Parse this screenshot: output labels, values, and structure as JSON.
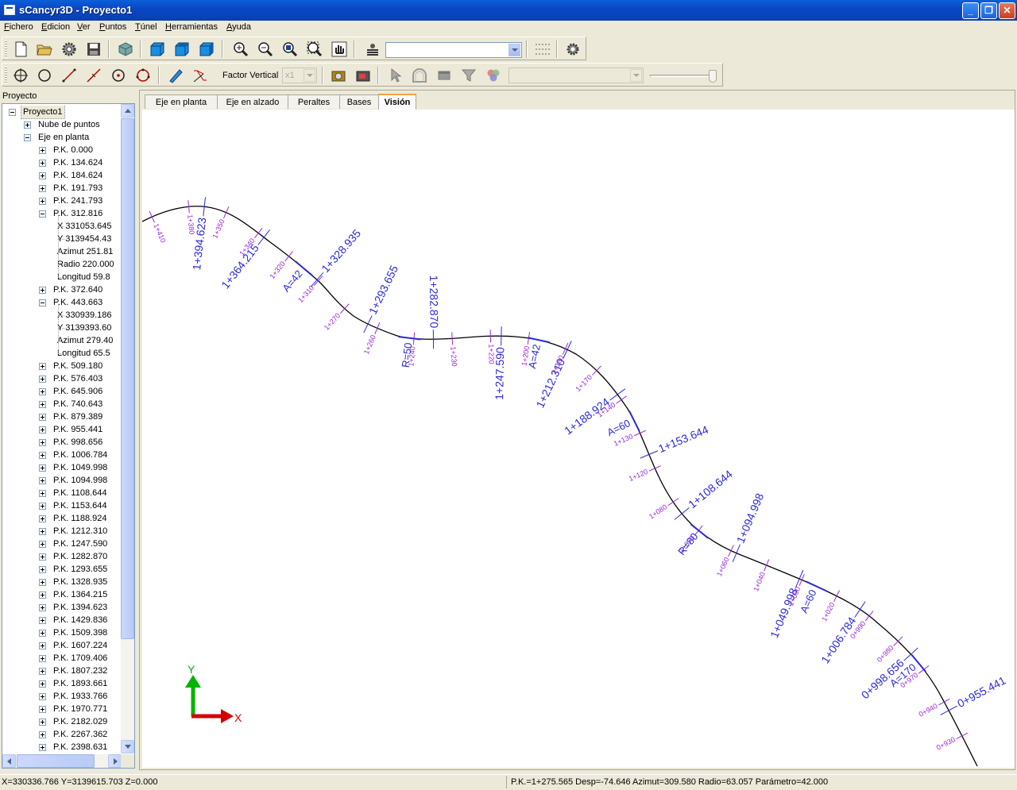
{
  "window": {
    "title": "sCancyr3D - Proyecto1",
    "buttons": {
      "minimize": "_",
      "restore": "❐",
      "close": "✕"
    }
  },
  "menu": [
    "Fichero",
    "Edicion",
    "Ver",
    "Puntos",
    "Túnel",
    "Herramientas",
    "Ayuda"
  ],
  "toolbar2": {
    "factor_label": "Factor Vertical",
    "factor_value": "x1"
  },
  "panel": {
    "header": "Proyecto",
    "tree": [
      {
        "label": "Proyecto1",
        "level": 0,
        "expander": "minus",
        "selected": true
      },
      {
        "label": "Nube de puntos",
        "level": 1,
        "expander": "plus"
      },
      {
        "label": "Eje en planta",
        "level": 1,
        "expander": "minus"
      },
      {
        "label": "P.K. 0.000",
        "level": 2,
        "expander": "plus"
      },
      {
        "label": "P.K. 134.624",
        "level": 2,
        "expander": "plus"
      },
      {
        "label": "P.K. 184.624",
        "level": 2,
        "expander": "plus"
      },
      {
        "label": "P.K. 191.793",
        "level": 2,
        "expander": "plus"
      },
      {
        "label": "P.K. 241.793",
        "level": 2,
        "expander": "plus"
      },
      {
        "label": "P.K. 312.816",
        "level": 2,
        "expander": "minus"
      },
      {
        "label": "X 331053.645",
        "level": 3,
        "expander": "none"
      },
      {
        "label": "Y 3139454.43",
        "level": 3,
        "expander": "none"
      },
      {
        "label": "Azimut 251.81",
        "level": 3,
        "expander": "none"
      },
      {
        "label": "Radio 220.000",
        "level": 3,
        "expander": "none"
      },
      {
        "label": "Longitud 59.8",
        "level": 3,
        "expander": "none"
      },
      {
        "label": "P.K. 372.640",
        "level": 2,
        "expander": "plus"
      },
      {
        "label": "P.K. 443.663",
        "level": 2,
        "expander": "minus"
      },
      {
        "label": "X 330939.186",
        "level": 3,
        "expander": "none"
      },
      {
        "label": "Y 3139393.60",
        "level": 3,
        "expander": "none"
      },
      {
        "label": "Azimut 279.40",
        "level": 3,
        "expander": "none"
      },
      {
        "label": "Longitud 65.5",
        "level": 3,
        "expander": "none"
      },
      {
        "label": "P.K. 509.180",
        "level": 2,
        "expander": "plus"
      },
      {
        "label": "P.K. 576.403",
        "level": 2,
        "expander": "plus"
      },
      {
        "label": "P.K. 645.906",
        "level": 2,
        "expander": "plus"
      },
      {
        "label": "P.K. 740.643",
        "level": 2,
        "expander": "plus"
      },
      {
        "label": "P.K. 879.389",
        "level": 2,
        "expander": "plus"
      },
      {
        "label": "P.K. 955.441",
        "level": 2,
        "expander": "plus"
      },
      {
        "label": "P.K. 998.656",
        "level": 2,
        "expander": "plus"
      },
      {
        "label": "P.K. 1006.784",
        "level": 2,
        "expander": "plus"
      },
      {
        "label": "P.K. 1049.998",
        "level": 2,
        "expander": "plus"
      },
      {
        "label": "P.K. 1094.998",
        "level": 2,
        "expander": "plus"
      },
      {
        "label": "P.K. 1108.644",
        "level": 2,
        "expander": "plus"
      },
      {
        "label": "P.K. 1153.644",
        "level": 2,
        "expander": "plus"
      },
      {
        "label": "P.K. 1188.924",
        "level": 2,
        "expander": "plus"
      },
      {
        "label": "P.K. 1212.310",
        "level": 2,
        "expander": "plus"
      },
      {
        "label": "P.K. 1247.590",
        "level": 2,
        "expander": "plus"
      },
      {
        "label": "P.K. 1282.870",
        "level": 2,
        "expander": "plus"
      },
      {
        "label": "P.K. 1293.655",
        "level": 2,
        "expander": "plus"
      },
      {
        "label": "P.K. 1328.935",
        "level": 2,
        "expander": "plus"
      },
      {
        "label": "P.K. 1364.215",
        "level": 2,
        "expander": "plus"
      },
      {
        "label": "P.K. 1394.623",
        "level": 2,
        "expander": "plus"
      },
      {
        "label": "P.K. 1429.836",
        "level": 2,
        "expander": "plus"
      },
      {
        "label": "P.K. 1509.398",
        "level": 2,
        "expander": "plus"
      },
      {
        "label": "P.K. 1607.224",
        "level": 2,
        "expander": "plus"
      },
      {
        "label": "P.K. 1709.406",
        "level": 2,
        "expander": "plus"
      },
      {
        "label": "P.K. 1807.232",
        "level": 2,
        "expander": "plus"
      },
      {
        "label": "P.K. 1893.661",
        "level": 2,
        "expander": "plus"
      },
      {
        "label": "P.K. 1933.766",
        "level": 2,
        "expander": "plus"
      },
      {
        "label": "P.K. 1970.771",
        "level": 2,
        "expander": "plus"
      },
      {
        "label": "P.K. 2182.029",
        "level": 2,
        "expander": "plus"
      },
      {
        "label": "P.K. 2267.362",
        "level": 2,
        "expander": "plus"
      },
      {
        "label": "P.K. 2398.631",
        "level": 2,
        "expander": "plus"
      }
    ]
  },
  "tabs": [
    {
      "label": "Eje en planta",
      "active": false
    },
    {
      "label": "Eje en alzado",
      "active": false
    },
    {
      "label": "Peraltes",
      "active": false
    },
    {
      "label": "Bases",
      "active": false
    },
    {
      "label": "Visión",
      "active": true
    }
  ],
  "view": {
    "colors": {
      "axis_line": "#000000",
      "major_label": "#2a2ad8",
      "minor_label": "#9a2ad8",
      "x_axis": "#d40000",
      "y_axis": "#00b400"
    },
    "axis_labels": {
      "x": "X",
      "y": "Y"
    },
    "major_stations": [
      "1+394.623",
      "1+364.215",
      "1+328.935",
      "1+293.655",
      "1+282.870",
      "1+247.590",
      "1+212.310",
      "1+188.924",
      "1+153.644",
      "1+108.644",
      "1+094.998",
      "1+049.998",
      "1+006.784",
      "0+998.656",
      "0+955.441"
    ],
    "minor_stations": [
      "1+410",
      "1+380",
      "1+350",
      "1+340",
      "1+320",
      "1+310",
      "1+270",
      "1+260",
      "1+240",
      "1+230",
      "1+220",
      "1+200",
      "1+180",
      "1+170",
      "1+140",
      "1+130",
      "1+120",
      "1+080",
      "1+070",
      "1+060",
      "1+040",
      "1+030",
      "1+020",
      "0+990",
      "0+980",
      "0+970",
      "0+940",
      "0+930"
    ],
    "parameters": [
      "A=42",
      "R=50",
      "A=42",
      "A=60",
      "R=80",
      "A=60",
      "A=170"
    ]
  },
  "status": {
    "coords": "X=330336.766 Y=3139615.703 Z=0.000",
    "info": "P.K.=1+275.565 Desp=-74.646 Azimut=309.580 Radio=63.057 Parámetro=42.000"
  }
}
